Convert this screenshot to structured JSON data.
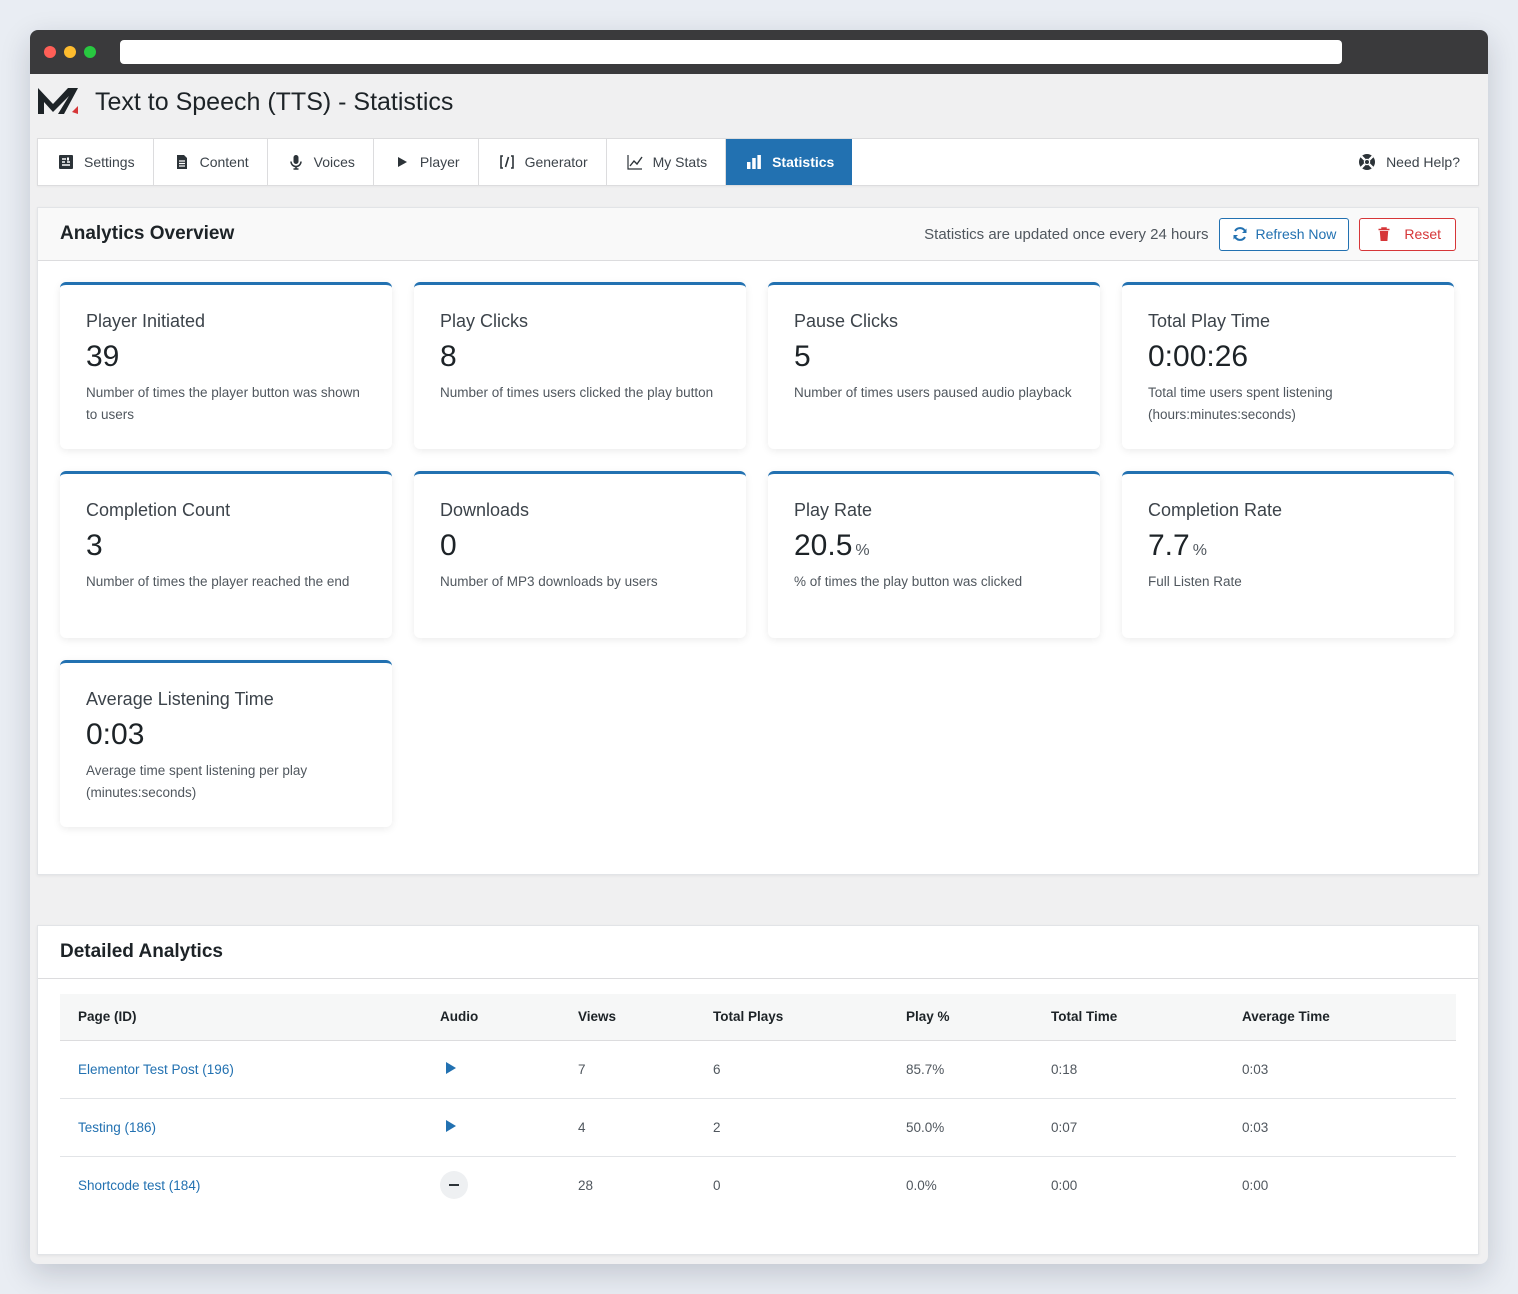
{
  "app": {
    "title": "Text to Speech (TTS) - Statistics"
  },
  "colors": {
    "accent": "#2271b1",
    "danger": "#d63638"
  },
  "tabs": [
    {
      "label": "Settings",
      "icon": "settings-icon"
    },
    {
      "label": "Content",
      "icon": "document-icon"
    },
    {
      "label": "Voices",
      "icon": "microphone-icon"
    },
    {
      "label": "Player",
      "icon": "play-icon"
    },
    {
      "label": "Generator",
      "icon": "code-icon"
    },
    {
      "label": "My Stats",
      "icon": "line-chart-icon"
    },
    {
      "label": "Statistics",
      "icon": "bar-chart-icon",
      "active": true
    }
  ],
  "help": {
    "label": "Need Help?"
  },
  "overview": {
    "title": "Analytics Overview",
    "update_note": "Statistics are updated once every 24 hours",
    "refresh_label": "Refresh Now",
    "reset_label": "Reset",
    "cards": [
      {
        "title": "Player Initiated",
        "value": "39",
        "unit": "",
        "desc": "Number of times the player button was shown to users"
      },
      {
        "title": "Play Clicks",
        "value": "8",
        "unit": "",
        "desc": "Number of times users clicked the play button"
      },
      {
        "title": "Pause Clicks",
        "value": "5",
        "unit": "",
        "desc": "Number of times users paused audio playback"
      },
      {
        "title": "Total Play Time",
        "value": "0:00:26",
        "unit": "",
        "desc": "Total time users spent listening (hours:minutes:seconds)"
      },
      {
        "title": "Completion Count",
        "value": "3",
        "unit": "",
        "desc": "Number of times the player reached the end"
      },
      {
        "title": "Downloads",
        "value": "0",
        "unit": "",
        "desc": "Number of MP3 downloads by users"
      },
      {
        "title": "Play Rate",
        "value": "20.5",
        "unit": "%",
        "desc": "% of times the play button was clicked"
      },
      {
        "title": "Completion Rate",
        "value": "7.7",
        "unit": "%",
        "desc": "Full Listen Rate"
      },
      {
        "title": "Average Listening Time",
        "value": "0:03",
        "unit": "",
        "desc": "Average time spent listening per play (minutes:seconds)"
      }
    ]
  },
  "detail": {
    "title": "Detailed Analytics",
    "columns": [
      "Page (ID)",
      "Audio",
      "Views",
      "Total Plays",
      "Play %",
      "Total Time",
      "Average Time"
    ],
    "rows": [
      {
        "page": "Elementor Test Post (196)",
        "audio": "play-icon",
        "views": "7",
        "plays": "6",
        "play_pct": "85.7%",
        "total_time": "0:18",
        "avg_time": "0:03"
      },
      {
        "page": "Testing (186)",
        "audio": "play-icon",
        "views": "4",
        "plays": "2",
        "play_pct": "50.0%",
        "total_time": "0:07",
        "avg_time": "0:03"
      },
      {
        "page": "Shortcode test (184)",
        "audio": "no-audio-icon",
        "views": "28",
        "plays": "0",
        "play_pct": "0.0%",
        "total_time": "0:00",
        "avg_time": "0:00"
      }
    ]
  }
}
